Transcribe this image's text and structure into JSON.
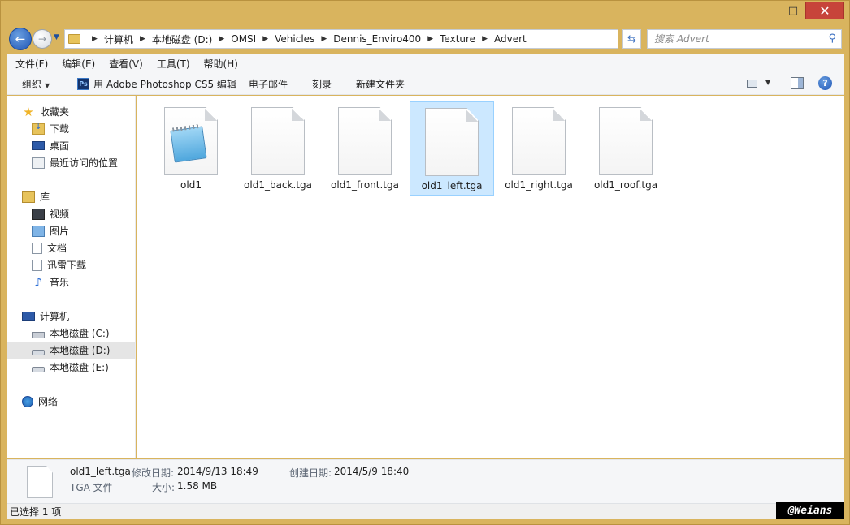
{
  "window": {
    "minimize_glyph": "—",
    "maximize_glyph": "□",
    "close_glyph": "✕"
  },
  "nav": {
    "breadcrumbs": [
      "计算机",
      "本地磁盘 (D:)",
      "OMSI",
      "Vehicles",
      "Dennis_Enviro400",
      "Texture",
      "Advert"
    ],
    "search_placeholder": "搜索 Advert"
  },
  "menubar": {
    "items": [
      "文件(F)",
      "编辑(E)",
      "查看(V)",
      "工具(T)",
      "帮助(H)"
    ]
  },
  "cmdbar": {
    "organize": "组织",
    "open_with": "用 Adobe Photoshop CS5 编辑",
    "email": "电子邮件",
    "burn": "刻录",
    "new_folder": "新建文件夹",
    "ps_badge": "Ps"
  },
  "sidebar": {
    "favorites": "收藏夹",
    "downloads": "下载",
    "desktop": "桌面",
    "recent": "最近访问的位置",
    "libraries": "库",
    "videos": "视频",
    "pictures": "图片",
    "documents": "文档",
    "xunlei": "迅雷下载",
    "music": "音乐",
    "computer": "计算机",
    "drive_c": "本地磁盘 (C:)",
    "drive_d": "本地磁盘 (D:)",
    "drive_e": "本地磁盘 (E:)",
    "network": "网络"
  },
  "files": [
    {
      "name": "old1",
      "icon": "notepad-icon",
      "selected": false
    },
    {
      "name": "old1_back.tga",
      "icon": "file-icon",
      "selected": false
    },
    {
      "name": "old1_front.tga",
      "icon": "file-icon",
      "selected": false
    },
    {
      "name": "old1_left.tga",
      "icon": "file-icon",
      "selected": true
    },
    {
      "name": "old1_right.tga",
      "icon": "file-icon",
      "selected": false
    },
    {
      "name": "old1_roof.tga",
      "icon": "file-icon",
      "selected": false
    }
  ],
  "details": {
    "filename": "old1_left.tga",
    "modified_label": "修改日期:",
    "modified_value": "2014/9/13 18:49",
    "created_label": "创建日期:",
    "created_value": "2014/5/9 18:40",
    "type": "TGA 文件",
    "size_label": "大小:",
    "size_value": "1.58 MB"
  },
  "status": {
    "text": "已选择 1 项",
    "watermark": "@Weians"
  },
  "colors": {
    "frame": "#d9b45e",
    "close": "#c7443a",
    "selection": "#cce8ff"
  }
}
